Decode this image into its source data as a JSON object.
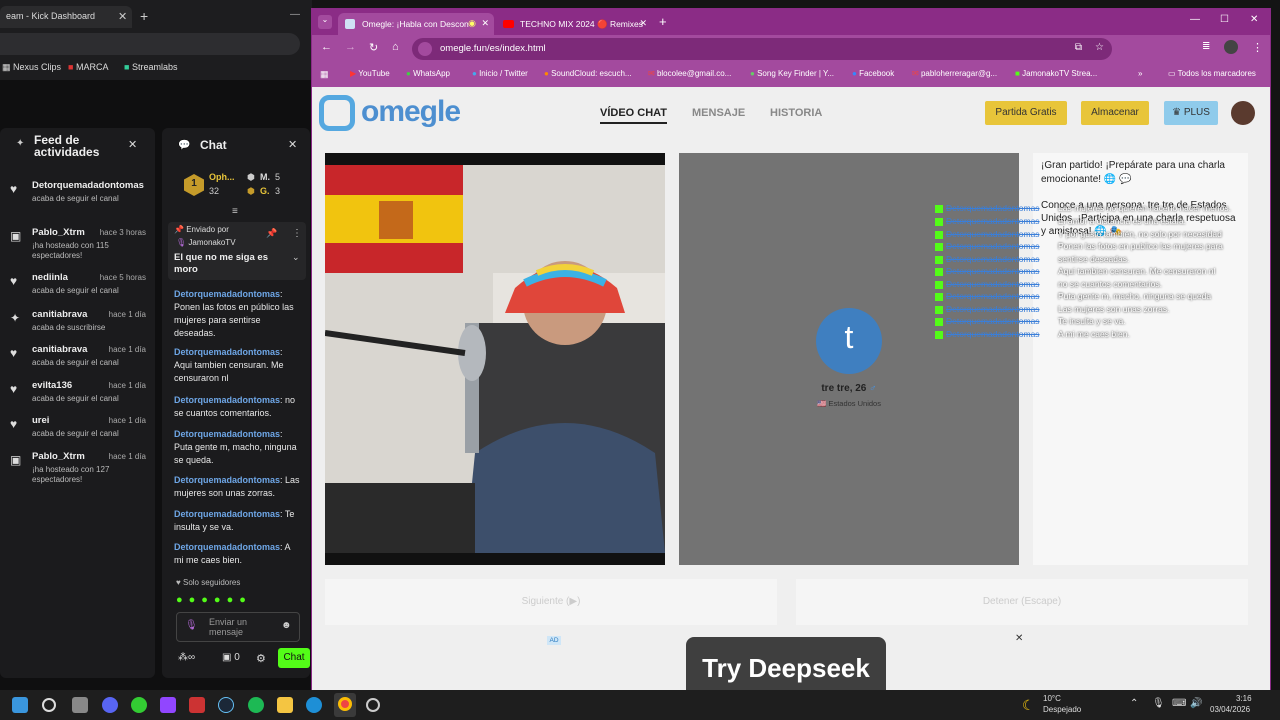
{
  "back_window": {
    "tab_title": "eam - Kick Dashboard",
    "bookmarks": [
      "Nexus Clips",
      "MARCA",
      "Streamlabs"
    ],
    "feed": {
      "title": "Feed de actividades",
      "items": [
        {
          "name": "Detorquemadadontomas",
          "time": "",
          "sub": "acaba de seguir el canal"
        },
        {
          "name": "Pablo_Xtrm",
          "time": "hace 3 horas",
          "sub": "¡ha hosteado con 115 espectadores!"
        },
        {
          "name": "nediinla",
          "time": "hace 5 horas",
          "sub": "acaba de seguir el canal"
        },
        {
          "name": "canitiabrava",
          "time": "hace 1 día",
          "sub": "acaba de suscribirse"
        },
        {
          "name": "canitiabrava",
          "time": "hace 1 día",
          "sub": "acaba de seguir el canal"
        },
        {
          "name": "evilta136",
          "time": "hace 1 día",
          "sub": "acaba de seguir el canal"
        },
        {
          "name": "urei",
          "time": "hace 1 día",
          "sub": "acaba de seguir el canal"
        },
        {
          "name": "Pablo_Xtrm",
          "time": "hace 1 día",
          "sub": "¡ha hosteado con 127 espectadores!"
        }
      ]
    },
    "chat": {
      "title": "Chat",
      "leader_1": "Oph...",
      "leader_1_count": "32",
      "leader_2": "M.",
      "leader_2_count": "5",
      "leader_3": "G.",
      "leader_3_count": "3",
      "pinned_label": "Enviado por",
      "pinned_user": "JamonakoTV",
      "pinned_text": "El que no me siga es moro",
      "messages": [
        {
          "user": "Detorquemadadontomas",
          "text": "Ponen las fotos en público las mujeres para sentirse deseadas."
        },
        {
          "user": "Detorquemadadontomas",
          "text": "Aqui tambien censuran. Me censuraron nl"
        },
        {
          "user": "Detorquemadadontomas",
          "text": "no se cuantos comentarios."
        },
        {
          "user": "Detorquemadadontomas",
          "text": "Puta gente m, macho, ninguna se queda."
        },
        {
          "user": "Detorquemadadontomas",
          "text": "Las mujeres son unas zorras."
        },
        {
          "user": "Detorquemadadontomas",
          "text": "Te insulta y se va."
        },
        {
          "user": "Detorquemadadontomas",
          "text": "A mi me caes bien."
        }
      ],
      "followers_only": "Solo seguidores",
      "input_placeholder": "Enviar un mensaje",
      "count_zero": "0",
      "send_label": "Chat"
    }
  },
  "main_window": {
    "tabs": [
      {
        "label": "Omegle: ¡Habla con Descon"
      },
      {
        "label": "TECHNO MIX 2024 🔴 Remixes"
      }
    ],
    "url": "omegle.fun/es/index.html",
    "bookmarks": [
      "YouTube",
      "WhatsApp",
      "Inicio / Twitter",
      "SoundCloud: escuch...",
      "blocolee@gmail.co...",
      "Song Key Finder | Y...",
      "Facebook",
      "pabloherreragar@g...",
      "JamonakoTV Strea..."
    ],
    "all_bookmarks": "Todos los marcadores",
    "site": {
      "logo_text": "omegle",
      "nav": [
        "VÍDEO CHAT",
        "MENSAJE",
        "HISTORIA"
      ],
      "btn_free": "Partida Gratis",
      "btn_store": "Almacenar",
      "btn_plus": "PLUS",
      "stranger_initial": "t",
      "stranger_name": "tre tre, 26",
      "stranger_country": "Estados Unidos",
      "chat_intro": "¡Gran partido! ¡Prepárate para una charla emocionante! 🌐 💬",
      "chat_meet": "Conoce a una persona: tre tre de Estados Unidos. ¡Participa en una charla respetuosa y amistosa! 🌐 🎭",
      "next_button": "Siguiente (▶)",
      "stop_button": "Detener (Escape)",
      "ad_label": "AD",
      "ad_text": "Try Deepseek"
    },
    "overlay": [
      "Las mujeres no quieren hacerlo hacer menos.",
      "El amor a distancia es una estafa.",
      "Y por gusto también, no solo por necesidad",
      "Ponen las fotos en publico las mujeres para",
      "sentirse deseadas.",
      "Aqui tambien censuran. Me censuraron nl",
      "no se cuantos comentarios.",
      "Puta gente m, macho, ninguna se queda",
      "Las mujeres son unas zorras.",
      "Te insulta y se va.",
      "A mi me caes bien."
    ],
    "overlay_user": "Detorquemadadontomas"
  },
  "taskbar": {
    "temp": "10°C",
    "weather": "Despejado",
    "time": "3:16",
    "date": "03/04/2026"
  },
  "colors": {
    "kick_green": "#53fc18",
    "browser_purple": "#8b2c86",
    "omegle_blue": "#4a90d9",
    "yellow_btn": "#e8c53a"
  }
}
